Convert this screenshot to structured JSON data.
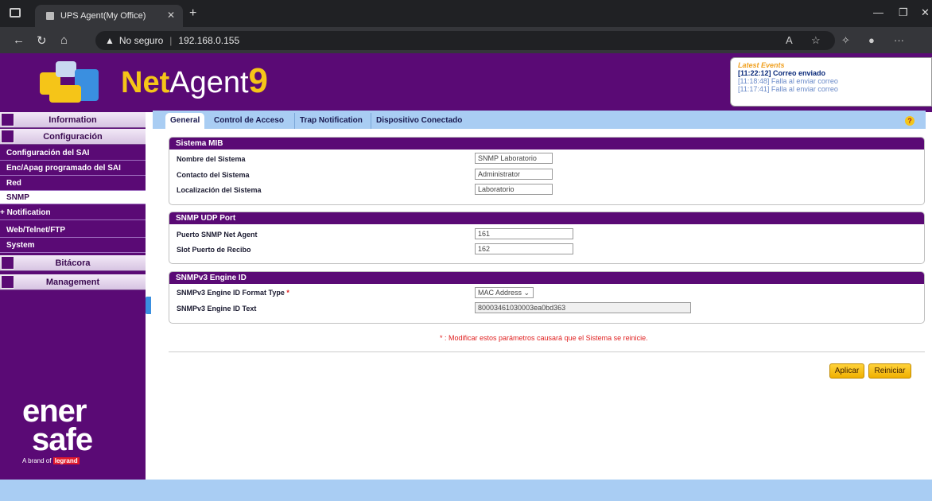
{
  "browser": {
    "tab_title": "UPS Agent(My Office)",
    "url_security": "No seguro",
    "url": "192.168.0.155"
  },
  "header": {
    "brand_prefix": "Net",
    "brand_main": "Agent",
    "brand_version": "9"
  },
  "events": {
    "title": "Latest Events",
    "items": [
      "[11:22:12] Correo enviado",
      "[11:18:48] Falla al enviar correo",
      "[11:17:41] Falla al enviar correo"
    ]
  },
  "sidebar": {
    "main_items": [
      {
        "label": "Information",
        "icon": "monitor-icon"
      },
      {
        "label": "Configuración",
        "icon": "gears-icon"
      },
      {
        "label": "Bitácora",
        "icon": "log-icon"
      },
      {
        "label": "Management",
        "icon": "grid-icon"
      }
    ],
    "sub_items": [
      "Configuración del SAI",
      "Enc/Apag programado del SAI",
      "Red",
      "SNMP",
      "+ Notification",
      "Web/Telnet/FTP",
      "System"
    ],
    "logo_line1": "ener",
    "logo_line2": "safe",
    "logo_tagline": "A brand of",
    "logo_brand": "legrand"
  },
  "tabs": [
    "General",
    "Control de Acceso",
    "Trap Notification",
    "Dispositivo Conectado"
  ],
  "sections": {
    "mib": {
      "title": "Sistema MIB",
      "rows": [
        {
          "label": "Nombre del Sistema",
          "value": "SNMP Laboratorio"
        },
        {
          "label": "Contacto del Sistema",
          "value": "Administrator"
        },
        {
          "label": "Localización del Sistema",
          "value": "Laboratorio"
        }
      ]
    },
    "udp": {
      "title": "SNMP UDP Port",
      "rows": [
        {
          "label": "Puerto SNMP Net Agent",
          "value": "161"
        },
        {
          "label": "Slot Puerto de Recibo",
          "value": "162"
        }
      ]
    },
    "engine": {
      "title": "SNMPv3 Engine ID",
      "rows": [
        {
          "label": "SNMPv3 Engine ID Format Type",
          "value": "MAC Address"
        },
        {
          "label": "SNMPv3 Engine ID Text",
          "value": "80003461030003ea0bd363"
        }
      ]
    }
  },
  "note": "* : Modificar estos parámetros causará que el Sistema se reinicie.",
  "buttons": {
    "apply": "Aplicar",
    "restart": "Reiniciar"
  },
  "help": "?",
  "colors": {
    "brand_purple": "#5a0a75",
    "accent_yellow": "#f5c518",
    "tab_blue": "#a9cdf3"
  }
}
